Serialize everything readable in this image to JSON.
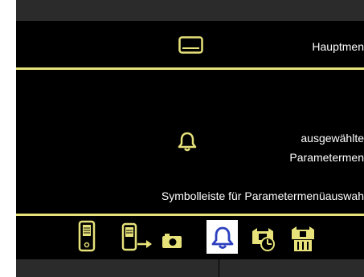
{
  "labels": {
    "main_menu": "Hauptmen",
    "selected_param_line1": "ausgewählte",
    "selected_param_line2": "Parametermen",
    "toolbar": "Symbolleiste für Parametermenüauswah"
  },
  "icons": {
    "main_menu": "display-icon",
    "selected_param": "bell-icon",
    "toolbar": [
      "device-icon",
      "device-export-icon",
      "camera-icon",
      "bell-icon",
      "timer-icon",
      "reset-icon"
    ],
    "selected_index": 3
  },
  "colors": {
    "accent": "#e7e27a",
    "selected_icon": "#2b3fbf",
    "background": "#000000",
    "text": "#ffffff"
  }
}
